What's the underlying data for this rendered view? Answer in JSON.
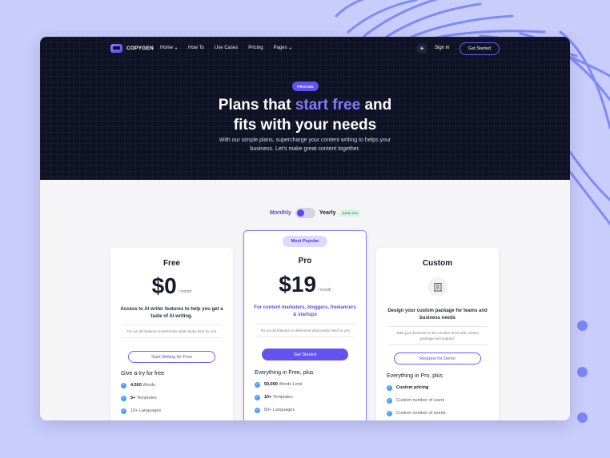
{
  "nav": {
    "logo_text": "COPYGEN",
    "menu": [
      {
        "label": "Home",
        "has_dropdown": true
      },
      {
        "label": "How To",
        "has_dropdown": false
      },
      {
        "label": "Use Cases",
        "has_dropdown": false
      },
      {
        "label": "Pricing",
        "has_dropdown": false
      },
      {
        "label": "Pages",
        "has_dropdown": true
      }
    ],
    "theme_icon": "sun-icon",
    "signin_label": "Sign in",
    "cta_label": "Get Started"
  },
  "hero": {
    "badge": "PRICING",
    "title_start": "Plans that ",
    "title_accent": "start free",
    "title_mid": " and",
    "title_line2": "fits with your needs",
    "subtitle_line1": "With our simple plans, supercharge your content writing to helps your",
    "subtitle_line2": "business. Let's make great content together."
  },
  "billing": {
    "monthly_label": "Monthly",
    "yearly_label": "Yearly",
    "save_badge": "SAVE 12%",
    "selected": "Monthly"
  },
  "plans": [
    {
      "name": "Free",
      "price": "$0",
      "period": "/ month",
      "description": "Access to AI writer features to help you get a taste of AI writing.",
      "note": "Try out all features to determine what works best for you",
      "button": "Start Writing for Free",
      "features_title": "Give a try for free",
      "features": [
        {
          "bold": "4,500",
          "text": " Words"
        },
        {
          "bold": "5+",
          "text": " Templates"
        },
        {
          "bold": "",
          "text": "10+ Languages"
        }
      ]
    },
    {
      "name": "Pro",
      "badge": "Most Popular",
      "price": "$19",
      "period": "/ month",
      "description": "For content marketers, bloggers, freelancers & startups",
      "note": "Try out all features to determine what works best for you",
      "button": "Get Started",
      "features_title": "Everything in Free, plus",
      "features": [
        {
          "bold": "50,000",
          "text": " Words Limit"
        },
        {
          "bold": "10+",
          "text": " Templates"
        },
        {
          "bold": "",
          "text": "50+ Languages"
        }
      ]
    },
    {
      "name": "Custom",
      "icon": "building-icon",
      "description": "Design your custom package for teams and business needs",
      "note": "Take your business to the another level with custom package and support.",
      "button": "Request for Demo",
      "features_title": "Everything in Pro, plus",
      "features": [
        {
          "bold": "Custom pricing",
          "text": ""
        },
        {
          "bold": "",
          "text": "Custom number of users"
        },
        {
          "bold": "",
          "text": "Custom number of words"
        }
      ]
    }
  ],
  "colors": {
    "background": "#c9cdfb",
    "hero": "#0f1225",
    "accent": "#6553f0",
    "check": "#4c9df5"
  }
}
